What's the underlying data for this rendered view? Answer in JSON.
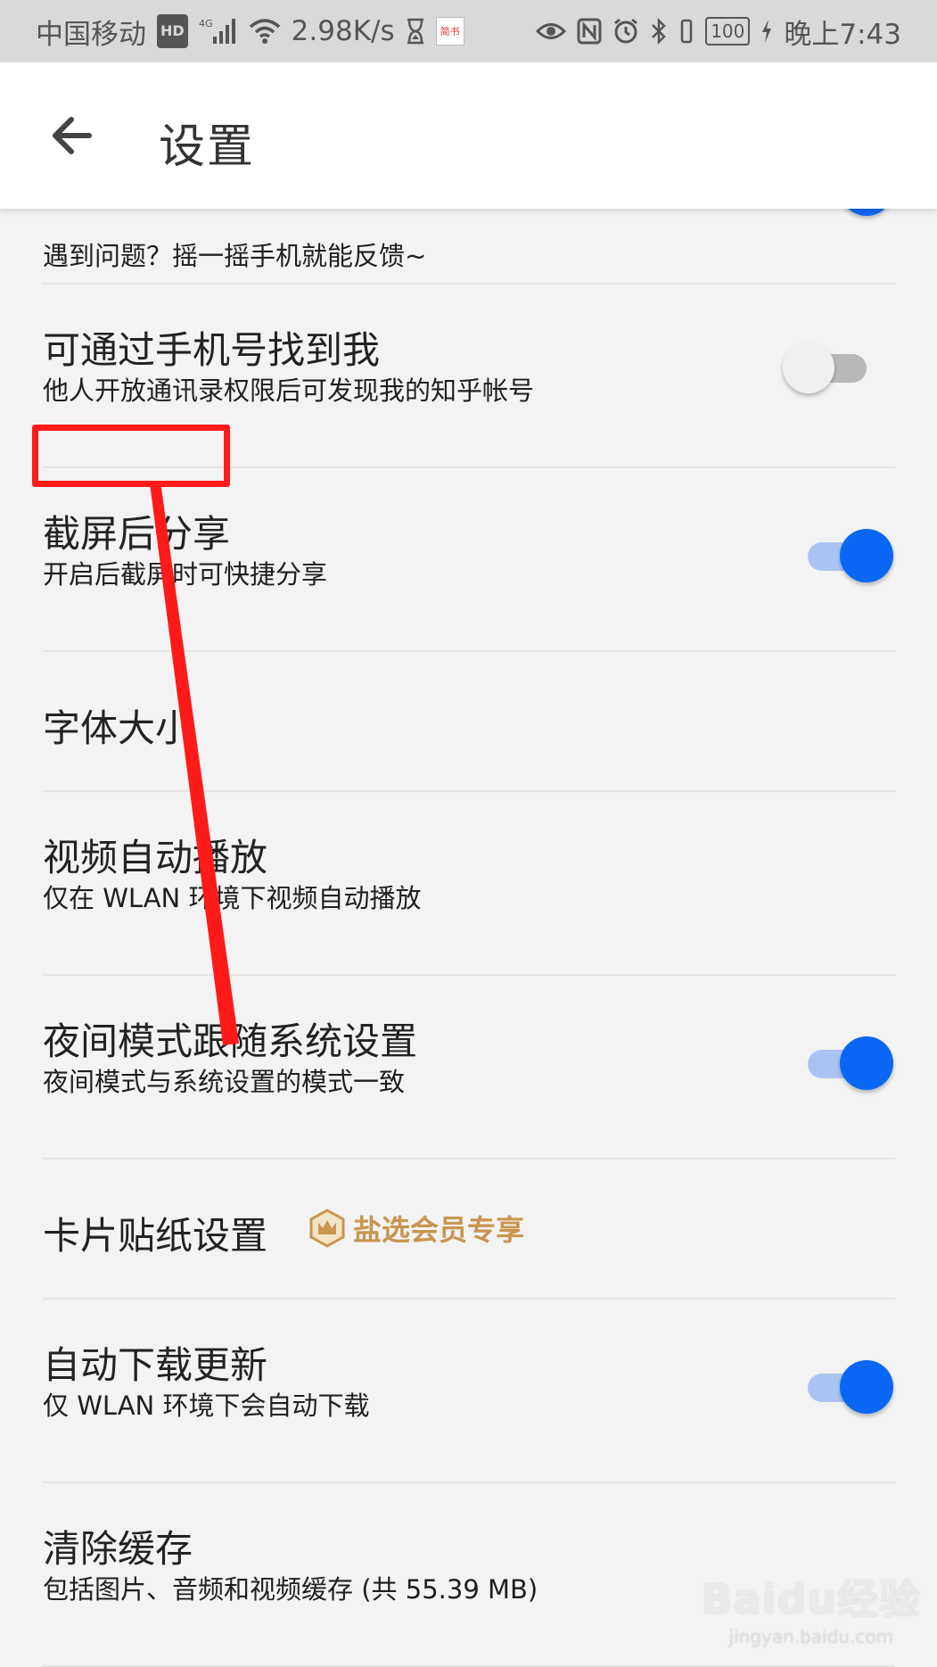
{
  "status_bar": {
    "carrier": "中国移动",
    "hd": "HD",
    "signal_label": "4G",
    "net_speed": "2.98K/s",
    "app_badge": "简书",
    "battery": "100",
    "time": "晚上7:43"
  },
  "app_bar": {
    "back_icon": "arrow-left-icon",
    "title": "设置"
  },
  "rows": [
    {
      "title": "",
      "subtitle": "遇到问题？摇一摇手机就能反馈~",
      "toggle": "on"
    },
    {
      "title": "可通过手机号找到我",
      "subtitle": "他人开放通讯录权限后可发现我的知乎帐号",
      "toggle": "off"
    },
    {
      "title": "截屏后分享",
      "subtitle": "开启后截屏时可快捷分享",
      "toggle": "on"
    },
    {
      "title": "字体大小",
      "subtitle": ""
    },
    {
      "title": "视频自动播放",
      "subtitle": "仅在 WLAN 环境下视频自动播放"
    },
    {
      "title": "夜间模式跟随系统设置",
      "subtitle": "夜间模式与系统设置的模式一致",
      "toggle": "on"
    },
    {
      "title": "卡片贴纸设置",
      "badge": "盐选会员专享"
    },
    {
      "title": "自动下载更新",
      "subtitle": "仅 WLAN 环境下会自动下载",
      "toggle": "on"
    },
    {
      "title": "清除缓存",
      "subtitle": "包括图片、音频和视频缓存 (共 55.39 MB)"
    }
  ],
  "watermark": {
    "logo": "Baidu经验",
    "url": "jingyan.baidu.com"
  },
  "colors": {
    "accent_blue": "#0a66f5",
    "toggle_track_on": "#a9c4f3",
    "member_gold": "#c8954f",
    "annotation_red": "#ff1a1a"
  }
}
